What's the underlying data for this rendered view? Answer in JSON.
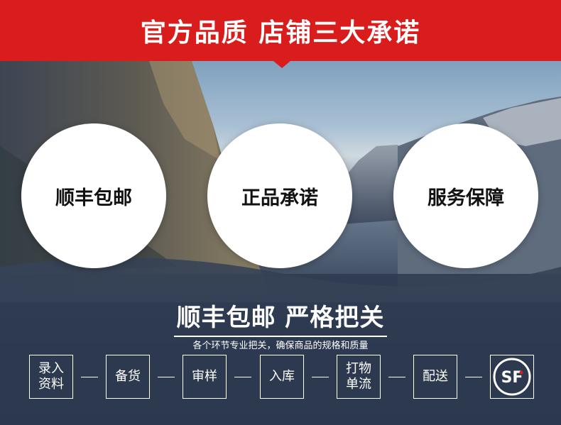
{
  "banner": {
    "title": "官方品质 店铺三大承诺"
  },
  "promises": [
    "顺丰包邮",
    "正品承诺",
    "服务保障"
  ],
  "section": {
    "title": "顺丰包邮 严格把关",
    "subtitle": "各个环节专业把关，确保商品的规格和质量"
  },
  "steps": [
    {
      "line1": "录入",
      "line2": "资料"
    },
    {
      "line1": "备货",
      "line2": ""
    },
    {
      "line1": "审样",
      "line2": ""
    },
    {
      "line1": "入库",
      "line2": ""
    },
    {
      "line1": "打物",
      "line2": "单流"
    },
    {
      "line1": "配送",
      "line2": ""
    }
  ],
  "sf_logo": {
    "text": "SF"
  },
  "colors": {
    "banner": "#d91d1d",
    "circle": "#ffffff",
    "sf_red": "#d91d1d"
  }
}
